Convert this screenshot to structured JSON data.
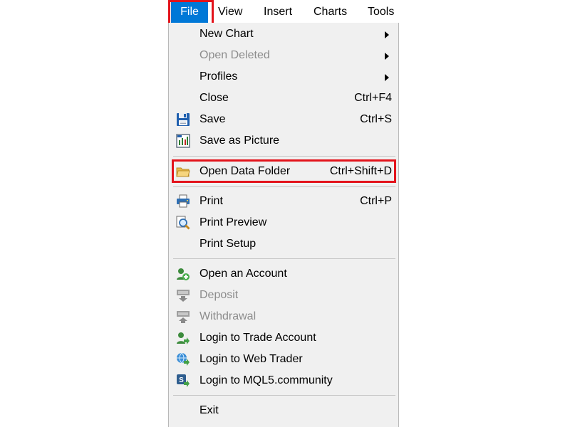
{
  "menubar": {
    "items": [
      {
        "label": "File",
        "active": true
      },
      {
        "label": "View"
      },
      {
        "label": "Insert"
      },
      {
        "label": "Charts"
      },
      {
        "label": "Tools"
      }
    ]
  },
  "file_menu": {
    "items": [
      {
        "label": "New Chart",
        "submenu": true,
        "icon": null,
        "enabled": true
      },
      {
        "label": "Open Deleted",
        "submenu": true,
        "icon": null,
        "enabled": false
      },
      {
        "label": "Profiles",
        "submenu": true,
        "icon": null,
        "enabled": true
      },
      {
        "label": "Close",
        "shortcut": "Ctrl+F4",
        "icon": null,
        "enabled": true
      },
      {
        "label": "Save",
        "shortcut": "Ctrl+S",
        "icon": "save-icon",
        "enabled": true
      },
      {
        "label": "Save as Picture",
        "icon": "save-picture-icon",
        "enabled": true
      },
      {
        "label": "Open Data Folder",
        "shortcut": "Ctrl+Shift+D",
        "icon": "folder-icon",
        "enabled": true,
        "highlighted": true
      },
      {
        "label": "Print",
        "shortcut": "Ctrl+P",
        "icon": "printer-icon",
        "enabled": true
      },
      {
        "label": "Print Preview",
        "icon": "print-preview-icon",
        "enabled": true
      },
      {
        "label": "Print Setup",
        "icon": null,
        "enabled": true
      },
      {
        "label": "Open an Account",
        "icon": "add-account-icon",
        "enabled": true
      },
      {
        "label": "Deposit",
        "icon": "deposit-icon",
        "enabled": false
      },
      {
        "label": "Withdrawal",
        "icon": "withdrawal-icon",
        "enabled": false
      },
      {
        "label": "Login to Trade Account",
        "icon": "login-account-icon",
        "enabled": true
      },
      {
        "label": "Login to Web Trader",
        "icon": "web-trader-icon",
        "enabled": true
      },
      {
        "label": "Login to MQL5.community",
        "icon": "mql5-icon",
        "enabled": true
      },
      {
        "label": "Exit",
        "icon": null,
        "enabled": true
      }
    ]
  },
  "colors": {
    "menu_background": "#f0f0f0",
    "active_menu": "#0078d7",
    "highlight_box": "#e3131b",
    "disabled_text": "#8c8c8c"
  }
}
